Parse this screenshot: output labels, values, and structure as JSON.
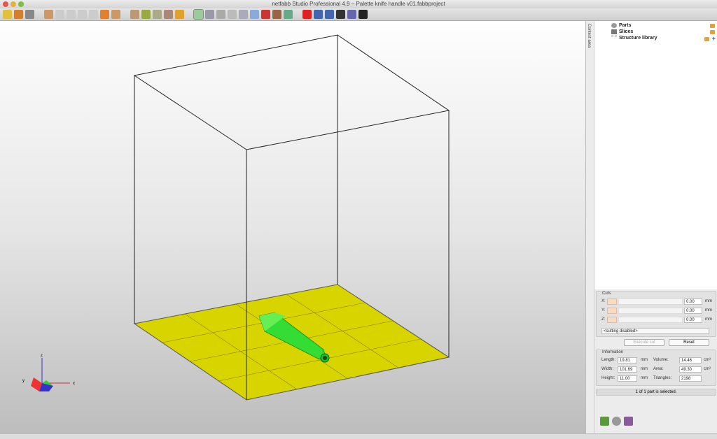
{
  "window": {
    "title": "netfabb Studio Professional 4.9 – Palette knife handle v01.fabbproject"
  },
  "toolbar": {
    "icons": [
      "new-project-icon",
      "add-part-icon",
      "history-icon",
      "view-front-icon",
      "view-back-icon",
      "view-left-icon",
      "view-right-icon",
      "view-top-icon",
      "view-bottom-icon",
      "view-iso-icon",
      "rotate-icon",
      "pan-icon",
      "zoom-box-icon",
      "zoom-all-icon",
      "zoom-icon",
      "select-icon",
      "measure-icon",
      "section-icon",
      "shading-icon",
      "label-icon",
      "mesh-icon",
      "color-icon",
      "texture-icon",
      "camera-icon",
      "repair-icon",
      "transform-icon",
      "ruler-icon",
      "check-icon",
      "scatter-icon",
      "pen-icon"
    ]
  },
  "sidebar": {
    "tab_label": "Context area",
    "tree": [
      {
        "label": "Parts"
      },
      {
        "label": "Slices"
      },
      {
        "label": "Structure library"
      }
    ]
  },
  "cuts": {
    "title": "Cuts",
    "axes": [
      {
        "label": "X:",
        "value": "0.00",
        "unit": "mm"
      },
      {
        "label": "Y:",
        "value": "0.00",
        "unit": "mm"
      },
      {
        "label": "Z:",
        "value": "0.00",
        "unit": "mm"
      }
    ],
    "mode": "<cutting disabled>",
    "execute_label": "Execute cut",
    "reset_label": "Reset"
  },
  "information": {
    "title": "Information",
    "length_label": "Length:",
    "length": "19.81",
    "width_label": "Width:",
    "width": "101.69",
    "height_label": "Height:",
    "height": "11.00",
    "unit": "mm",
    "volume_label": "Volume:",
    "volume": "14.46",
    "volume_unit": "cm³",
    "area_label": "Area:",
    "area": "49.30",
    "area_unit": "cm²",
    "triangles_label": "Triangles:",
    "triangles": "2198"
  },
  "status": "1 of 1 part is selected.",
  "axes": {
    "x": "x",
    "y": "y",
    "z": "z"
  },
  "colors": {
    "platform": "#d8d400",
    "part": "#22cc22"
  }
}
